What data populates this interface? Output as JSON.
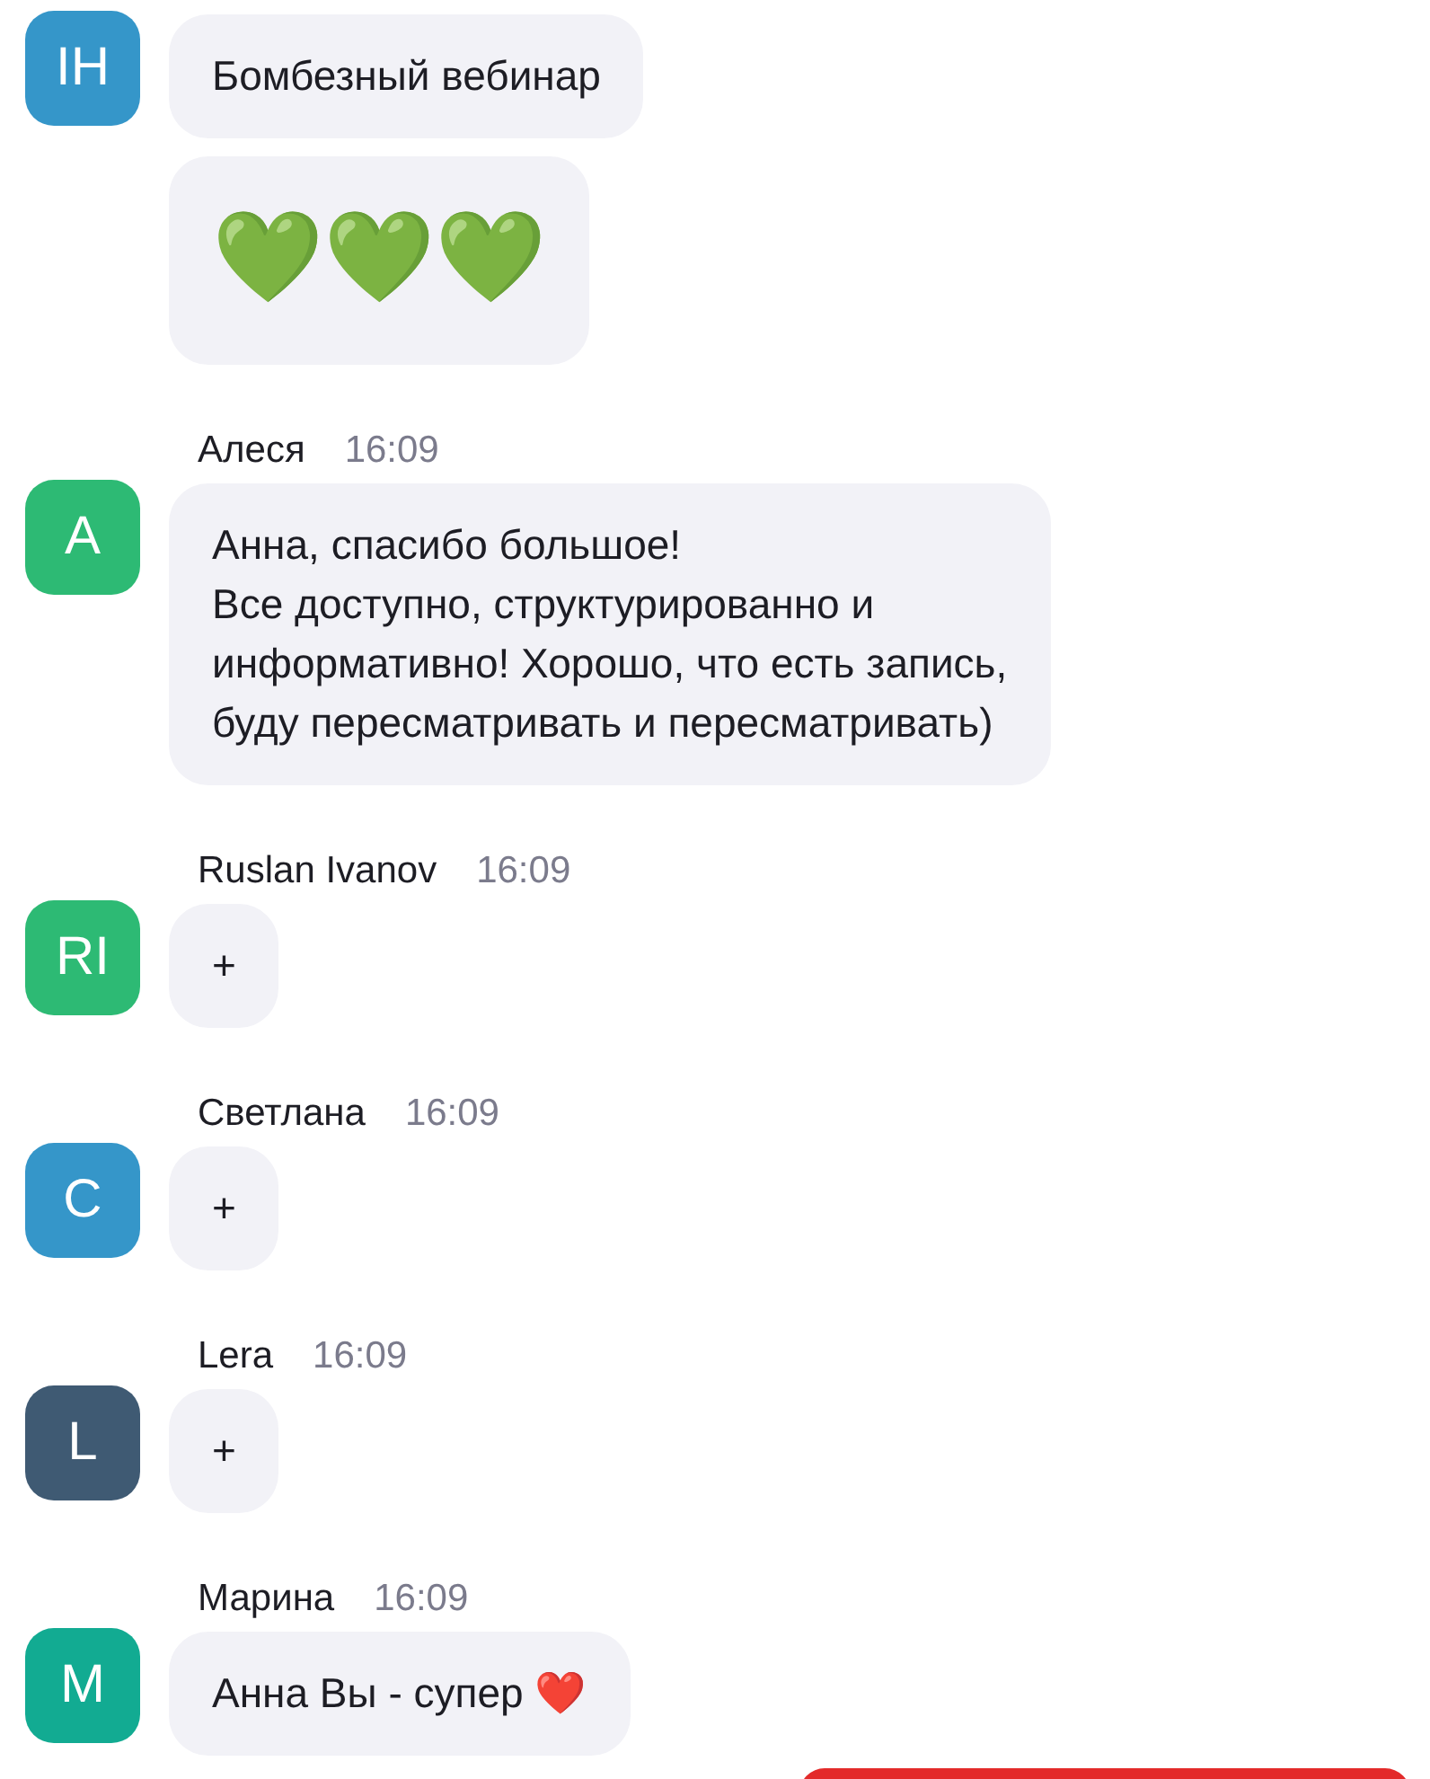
{
  "messages": [
    {
      "initials": "IH",
      "color": "#3596c9",
      "bubbles": [
        {
          "kind": "text",
          "text": "Бомбезный вебинар"
        },
        {
          "kind": "emoji",
          "text": "💚💚💚"
        }
      ]
    },
    {
      "author": "Алеся",
      "time": "16:09",
      "initials": "А",
      "color": "#2dba74",
      "bubbles": [
        {
          "kind": "text",
          "text": "Анна, спасибо большое!\nВсе доступно, структурированно и\nинформативно! Хорошо, что есть запись,\nбуду пересматривать и пересматривать)"
        }
      ]
    },
    {
      "author": "Ruslan Ivanov",
      "time": "16:09",
      "initials": "RI",
      "color": "#2dba74",
      "bubbles": [
        {
          "kind": "text",
          "text": "+"
        }
      ]
    },
    {
      "author": "Светлана",
      "time": "16:09",
      "initials": "С",
      "color": "#3596c9",
      "bubbles": [
        {
          "kind": "text",
          "text": "+"
        }
      ]
    },
    {
      "author": "Lera",
      "time": "16:09",
      "initials": "L",
      "color": "#3f5a73",
      "bubbles": [
        {
          "kind": "text",
          "text": "+"
        }
      ]
    },
    {
      "author": "Марина",
      "time": "16:09",
      "initials": "M",
      "color": "#12ab92",
      "bubbles": [
        {
          "kind": "text",
          "text": "Анна Вы - супер ❤️"
        }
      ]
    }
  ],
  "overlay": {
    "kind": "banner"
  }
}
